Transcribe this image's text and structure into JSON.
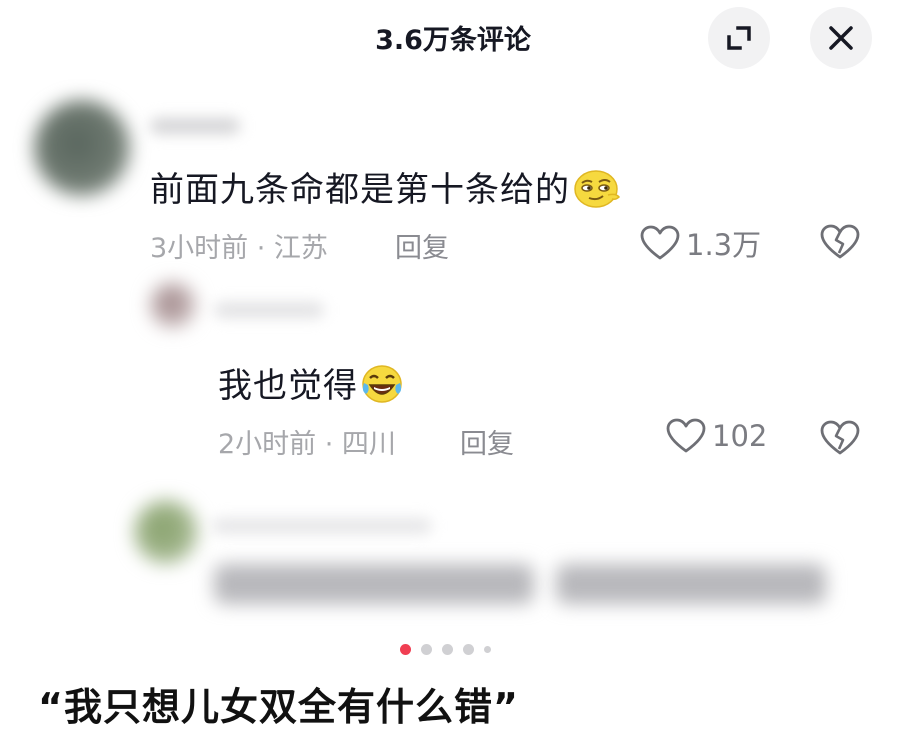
{
  "header": {
    "title": "3.6万条评论",
    "expand_icon": "expand-icon",
    "close_icon": "close-icon"
  },
  "comments": [
    {
      "text": "前面九条命都是第十条给的",
      "emoji": "smirk-emoji",
      "time_location": "3小时前 · 江苏",
      "reply_label": "回复",
      "like_count": "1.3万"
    },
    {
      "text": "我也觉得",
      "emoji": "laughing-tears-emoji",
      "time_location": "2小时前 · 四川",
      "reply_label": "回复",
      "like_count": "102"
    }
  ],
  "pagination": {
    "total": 5,
    "active_index": 0
  },
  "caption": "“我只想儿女双全有什么错”",
  "colors": {
    "active_dot": "#f03e52",
    "meta_text": "#a6a7ab",
    "title_text": "#161823"
  }
}
